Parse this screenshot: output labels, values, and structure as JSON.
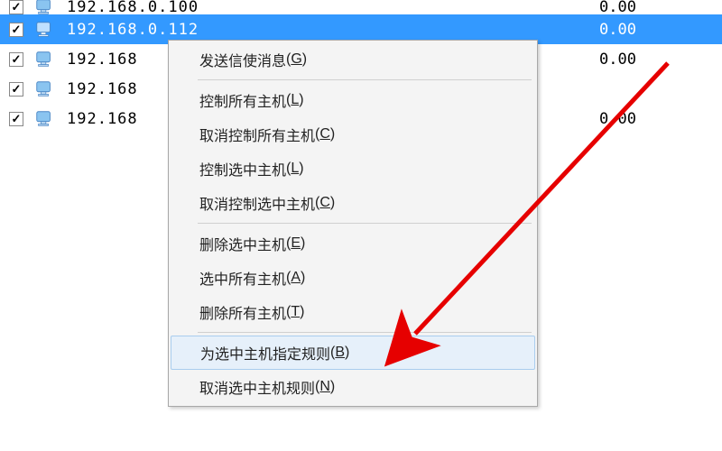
{
  "hosts": [
    {
      "ip": "192.168.0.100",
      "value": "0.00",
      "checked": true,
      "selected": false,
      "partial": true
    },
    {
      "ip": "192.168.0.112",
      "value": "0.00",
      "checked": true,
      "selected": true,
      "partial": false
    },
    {
      "ip": "192.168",
      "value": "0.00",
      "checked": true,
      "selected": false,
      "partial": false
    },
    {
      "ip": "192.168",
      "value": "",
      "checked": true,
      "selected": false,
      "partial": false
    },
    {
      "ip": "192.168",
      "value": "0.00",
      "checked": true,
      "selected": false,
      "partial": false
    }
  ],
  "menu": {
    "items": [
      {
        "label": "发送信使消息",
        "mnemonic": "G"
      },
      {
        "sep": true
      },
      {
        "label": "控制所有主机",
        "mnemonic": "L"
      },
      {
        "label": "取消控制所有主机",
        "mnemonic": "C"
      },
      {
        "label": "控制选中主机",
        "mnemonic": "L"
      },
      {
        "label": "取消控制选中主机",
        "mnemonic": "C"
      },
      {
        "sep": true
      },
      {
        "label": "删除选中主机",
        "mnemonic": "E"
      },
      {
        "label": "选中所有主机",
        "mnemonic": "A"
      },
      {
        "label": "删除所有主机",
        "mnemonic": "T"
      },
      {
        "sep": true
      },
      {
        "label": "为选中主机指定规则",
        "mnemonic": "B",
        "hover": true
      },
      {
        "label": "取消选中主机规则",
        "mnemonic": "N"
      }
    ]
  }
}
